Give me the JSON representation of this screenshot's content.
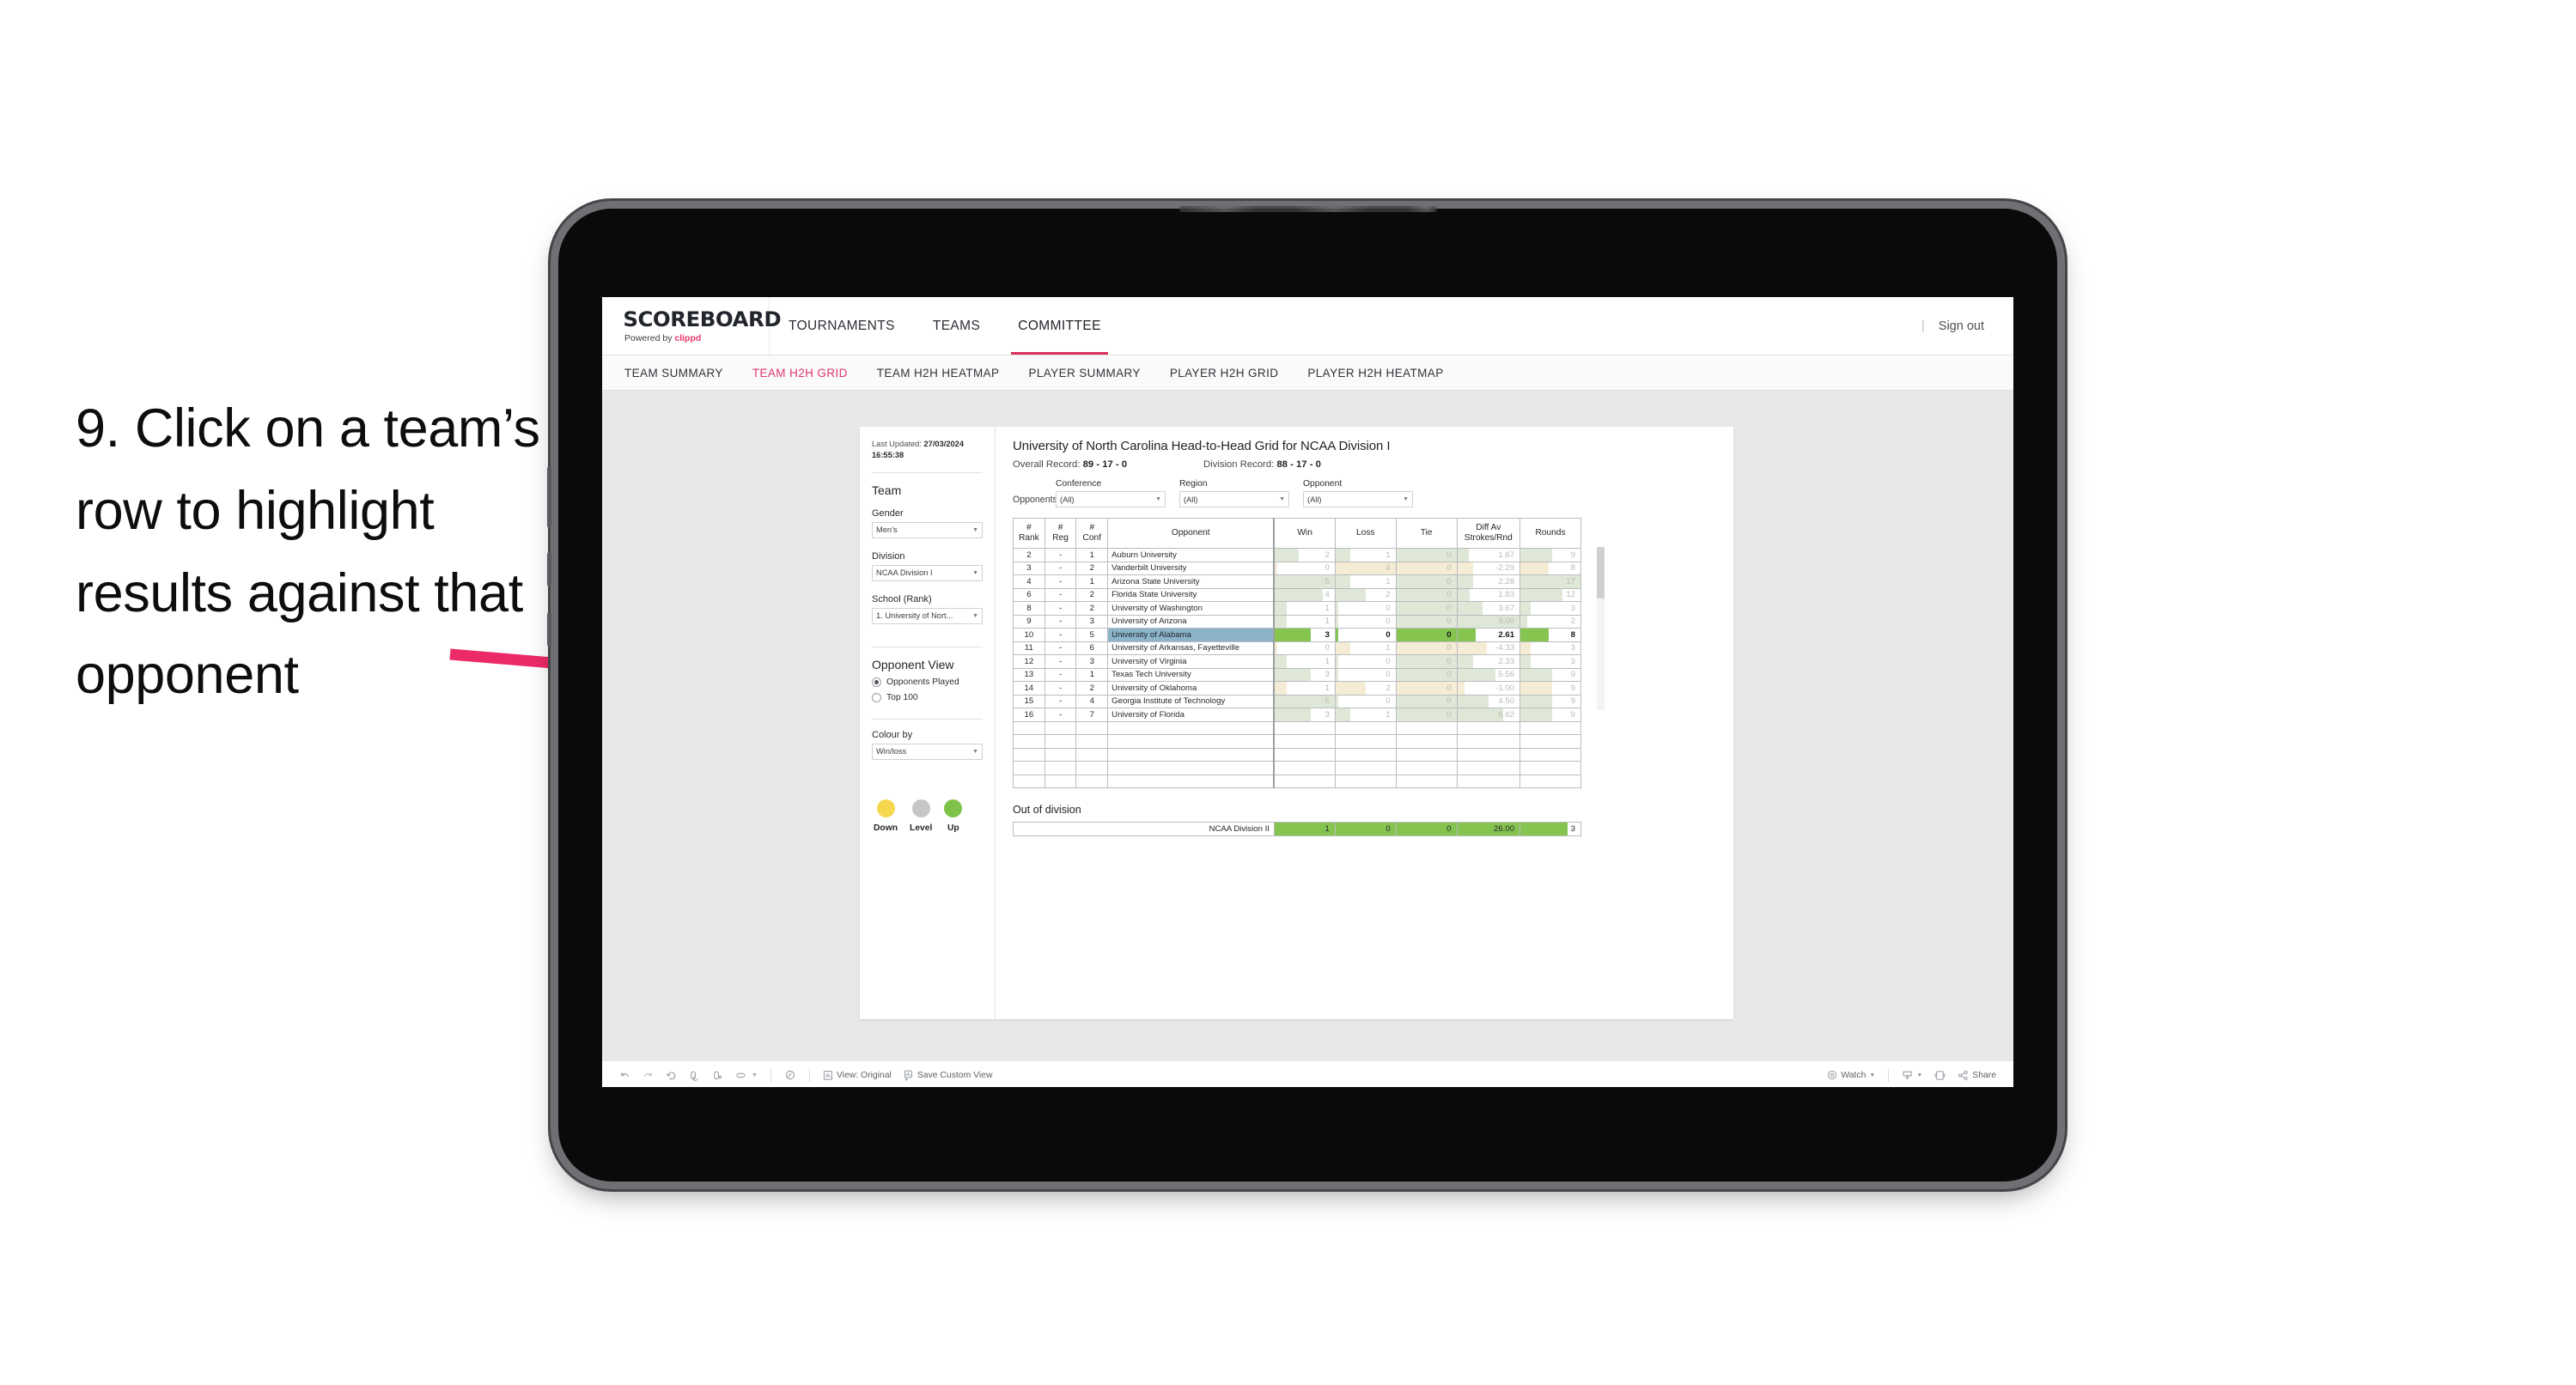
{
  "annotation": {
    "text": "9. Click on a team’s row to highlight results against that opponent",
    "arrow_color": "#ec2a67"
  },
  "app": {
    "brand": {
      "title": "SCOREBOARD",
      "powered_prefix": "Powered by ",
      "powered_name": "clippd"
    },
    "top_nav": [
      {
        "label": "TOURNAMENTS",
        "active": false
      },
      {
        "label": "TEAMS",
        "active": false
      },
      {
        "label": "COMMITTEE",
        "active": true
      }
    ],
    "top_right": {
      "separator": "|",
      "sign_out": "Sign out"
    },
    "sub_nav": [
      {
        "label": "TEAM SUMMARY",
        "active": false
      },
      {
        "label": "TEAM H2H GRID",
        "active": true
      },
      {
        "label": "TEAM H2H HEATMAP",
        "active": false
      },
      {
        "label": "PLAYER SUMMARY",
        "active": false
      },
      {
        "label": "PLAYER H2H GRID",
        "active": false
      },
      {
        "label": "PLAYER H2H HEATMAP",
        "active": false
      }
    ]
  },
  "filters": {
    "last_updated_label": "Last Updated: ",
    "last_updated_value": "27/03/2024 16:55:38",
    "team_heading": "Team",
    "gender": {
      "label": "Gender",
      "value": "Men’s"
    },
    "division": {
      "label": "Division",
      "value": "NCAA Division I"
    },
    "school": {
      "label": "School (Rank)",
      "value": "1. University of Nort..."
    },
    "opponent_view": {
      "heading": "Opponent View",
      "options": [
        {
          "label": "Opponents Played",
          "selected": true
        },
        {
          "label": "Top 100",
          "selected": false
        }
      ]
    },
    "colour_by": {
      "label": "Colour by",
      "value": "Win/loss"
    },
    "legend": [
      {
        "label": "Down",
        "color": "#f5d84e"
      },
      {
        "label": "Level",
        "color": "#c4c6c8"
      },
      {
        "label": "Up",
        "color": "#7ec24a"
      }
    ]
  },
  "viz": {
    "title": "University of North Carolina Head-to-Head Grid for NCAA Division I",
    "overall_record_label": "Overall Record: ",
    "overall_record_value": "89 - 17 - 0",
    "division_record_label": "Division Record: ",
    "division_record_value": "88 - 17 - 0",
    "opponents_label": "Opponents:",
    "opponent_filters": [
      {
        "label": "Conference",
        "value": "(All)"
      },
      {
        "label": "Region",
        "value": "(All)"
      },
      {
        "label": "Opponent",
        "value": "(All)"
      }
    ],
    "out_of_division_title": "Out of division"
  },
  "chart_data": {
    "type": "table",
    "title": "University of North Carolina Head-to-Head Grid for NCAA Division I",
    "columns": [
      "# Rank",
      "# Reg",
      "# Conf",
      "Opponent",
      "Win",
      "Loss",
      "Tie",
      "Diff Av Strokes/Rnd",
      "Rounds"
    ],
    "rows": [
      {
        "rank": "2",
        "reg": "-",
        "conf": "1",
        "opponent": "Auburn University",
        "win": "2",
        "loss": "1",
        "tie": "0",
        "diff": "1.67",
        "rounds": "9",
        "state": "up",
        "highlight": false
      },
      {
        "rank": "3",
        "reg": "-",
        "conf": "2",
        "opponent": "Vanderbilt University",
        "win": "0",
        "loss": "4",
        "tie": "0",
        "diff": "-2.29",
        "rounds": "8",
        "state": "down",
        "highlight": false
      },
      {
        "rank": "4",
        "reg": "-",
        "conf": "1",
        "opponent": "Arizona State University",
        "win": "5",
        "loss": "1",
        "tie": "0",
        "diff": "2.28",
        "rounds": "17",
        "state": "up",
        "highlight": false
      },
      {
        "rank": "6",
        "reg": "-",
        "conf": "2",
        "opponent": "Florida State University",
        "win": "4",
        "loss": "2",
        "tie": "0",
        "diff": "1.83",
        "rounds": "12",
        "state": "up",
        "highlight": false
      },
      {
        "rank": "8",
        "reg": "-",
        "conf": "2",
        "opponent": "University of Washington",
        "win": "1",
        "loss": "0",
        "tie": "0",
        "diff": "3.67",
        "rounds": "3",
        "state": "up",
        "highlight": false
      },
      {
        "rank": "9",
        "reg": "-",
        "conf": "3",
        "opponent": "University of Arizona",
        "win": "1",
        "loss": "0",
        "tie": "0",
        "diff": "9.00",
        "rounds": "2",
        "state": "up",
        "highlight": false
      },
      {
        "rank": "10",
        "reg": "-",
        "conf": "5",
        "opponent": "University of Alabama",
        "win": "3",
        "loss": "0",
        "tie": "0",
        "diff": "2.61",
        "rounds": "8",
        "state": "up",
        "highlight": true
      },
      {
        "rank": "11",
        "reg": "-",
        "conf": "6",
        "opponent": "University of Arkansas, Fayetteville",
        "win": "0",
        "loss": "1",
        "tie": "0",
        "diff": "-4.33",
        "rounds": "3",
        "state": "down",
        "highlight": false
      },
      {
        "rank": "12",
        "reg": "-",
        "conf": "3",
        "opponent": "University of Virginia",
        "win": "1",
        "loss": "0",
        "tie": "0",
        "diff": "2.33",
        "rounds": "3",
        "state": "up",
        "highlight": false
      },
      {
        "rank": "13",
        "reg": "-",
        "conf": "1",
        "opponent": "Texas Tech University",
        "win": "3",
        "loss": "0",
        "tie": "0",
        "diff": "5.56",
        "rounds": "9",
        "state": "up",
        "highlight": false
      },
      {
        "rank": "14",
        "reg": "-",
        "conf": "2",
        "opponent": "University of Oklahoma",
        "win": "1",
        "loss": "2",
        "tie": "0",
        "diff": "-1.00",
        "rounds": "9",
        "state": "down",
        "highlight": false
      },
      {
        "rank": "15",
        "reg": "-",
        "conf": "4",
        "opponent": "Georgia Institute of Technology",
        "win": "5",
        "loss": "0",
        "tie": "0",
        "diff": "4.50",
        "rounds": "9",
        "state": "up",
        "highlight": false
      },
      {
        "rank": "16",
        "reg": "-",
        "conf": "7",
        "opponent": "University of Florida",
        "win": "3",
        "loss": "1",
        "tie": "0",
        "diff": "6.62",
        "rounds": "9",
        "state": "up",
        "highlight": false
      }
    ],
    "out_of_division": [
      {
        "opponent": "NCAA Division II",
        "win": "1",
        "loss": "0",
        "tie": "0",
        "diff": "26.00",
        "rounds": "3"
      }
    ],
    "colors": {
      "up": "#dfe8d7",
      "down": "#f4ecd4",
      "highlight_row": "#8bb4c9",
      "highlight_fill": "#84c44f",
      "selected_opponent": "#8bb4c9"
    }
  },
  "toolbar": {
    "items": [
      {
        "name": "undo",
        "label": ""
      },
      {
        "name": "redo",
        "label": ""
      },
      {
        "name": "revert",
        "label": ""
      },
      {
        "name": "refresh",
        "label": ""
      },
      {
        "name": "pause",
        "label": ""
      },
      {
        "name": "data-source",
        "label": ""
      },
      {
        "name": "alerts",
        "label": ""
      }
    ],
    "view_original": "View: Original",
    "save_custom_view": "Save Custom View",
    "watch": "Watch",
    "share": "Share"
  }
}
